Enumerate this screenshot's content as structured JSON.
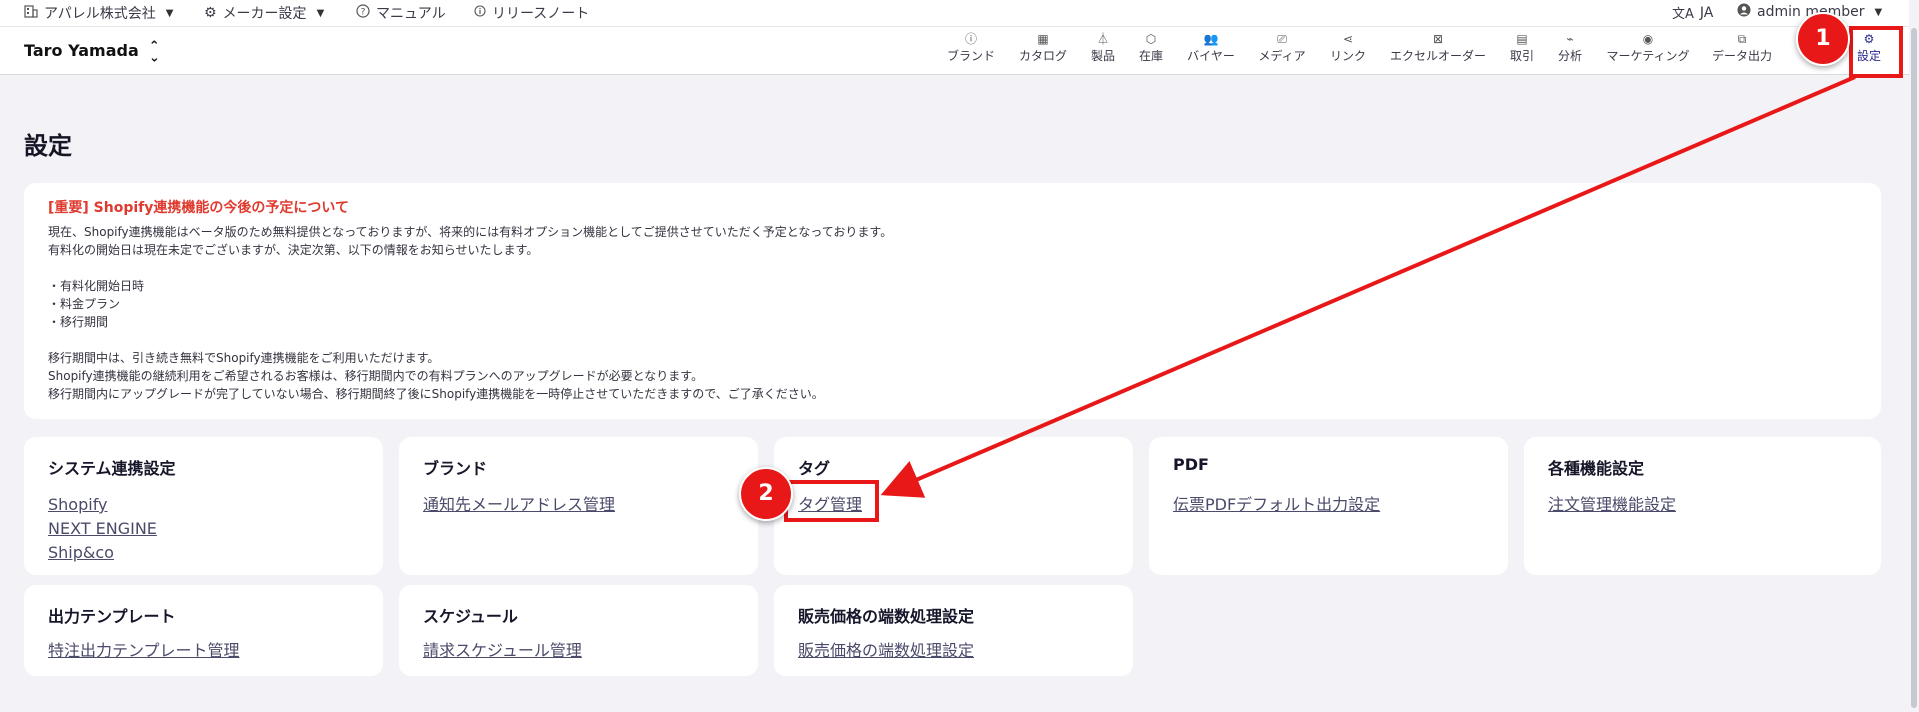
{
  "topbar": {
    "company": "アパレル株式会社",
    "maker_settings": "メーカー設定",
    "manual": "マニュアル",
    "release_notes": "リリースノート",
    "language": "JA",
    "user": "admin member"
  },
  "appbar": {
    "shop_name": "Taro Yamada",
    "nav": [
      {
        "label": "ブランド",
        "icon": "info-icon"
      },
      {
        "label": "カタログ",
        "icon": "grid-icon"
      },
      {
        "label": "製品",
        "icon": "hanger-icon"
      },
      {
        "label": "在庫",
        "icon": "boxes-icon"
      },
      {
        "label": "バイヤー",
        "icon": "people-icon"
      },
      {
        "label": "メディア",
        "icon": "cast-icon"
      },
      {
        "label": "リンク",
        "icon": "share-icon"
      },
      {
        "label": "エクセルオーダー",
        "icon": "excel-icon"
      },
      {
        "label": "取引",
        "icon": "message-icon"
      },
      {
        "label": "分析",
        "icon": "chart-icon"
      },
      {
        "label": "マーケティング",
        "icon": "broadcast-icon"
      },
      {
        "label": "データ出力",
        "icon": "copy-icon"
      },
      {
        "label": "設定",
        "icon": "gear-icon"
      }
    ]
  },
  "page": {
    "title": "設定"
  },
  "notice": {
    "title": "[重要] Shopify連携機能の今後の予定について",
    "lines": [
      "現在、Shopify連携機能はベータ版のため無料提供となっておりますが、将来的には有料オプション機能としてご提供させていただく予定となっております。",
      "有料化の開始日は現在未定でございますが、決定次第、以下の情報をお知らせいたします。",
      "",
      "・有料化開始日時",
      "・料金プラン",
      "・移行期間",
      "",
      "移行期間中は、引き続き無料でShopify連携機能をご利用いただけます。",
      "Shopify連携機能の継続利用をご希望されるお客様は、移行期間内での有料プランへのアップグレードが必要となります。",
      "移行期間内にアップグレードが完了していない場合、移行期間終了後にShopify連携機能を一時停止させていただきますので、ご了承ください。"
    ]
  },
  "cards": [
    {
      "title": "システム連携設定",
      "links": [
        "Shopify",
        "NEXT ENGINE",
        "Ship&co"
      ]
    },
    {
      "title": "ブランド",
      "links": [
        "通知先メールアドレス管理"
      ]
    },
    {
      "title": "タグ",
      "links": [
        "タグ管理"
      ]
    },
    {
      "title": "PDF",
      "links": [
        "伝票PDFデフォルト出力設定"
      ]
    },
    {
      "title": "各種機能設定",
      "links": [
        "注文管理機能設定"
      ]
    },
    {
      "title": "出力テンプレート",
      "links": [
        "特注出力テンプレート管理"
      ]
    },
    {
      "title": "スケジュール",
      "links": [
        "請求スケジュール管理"
      ]
    },
    {
      "title": "販売価格の端数処理設定",
      "links": [
        "販売価格の端数処理設定"
      ]
    }
  ],
  "annotations": {
    "step1": "1",
    "step2": "2",
    "color": "#e81818"
  }
}
